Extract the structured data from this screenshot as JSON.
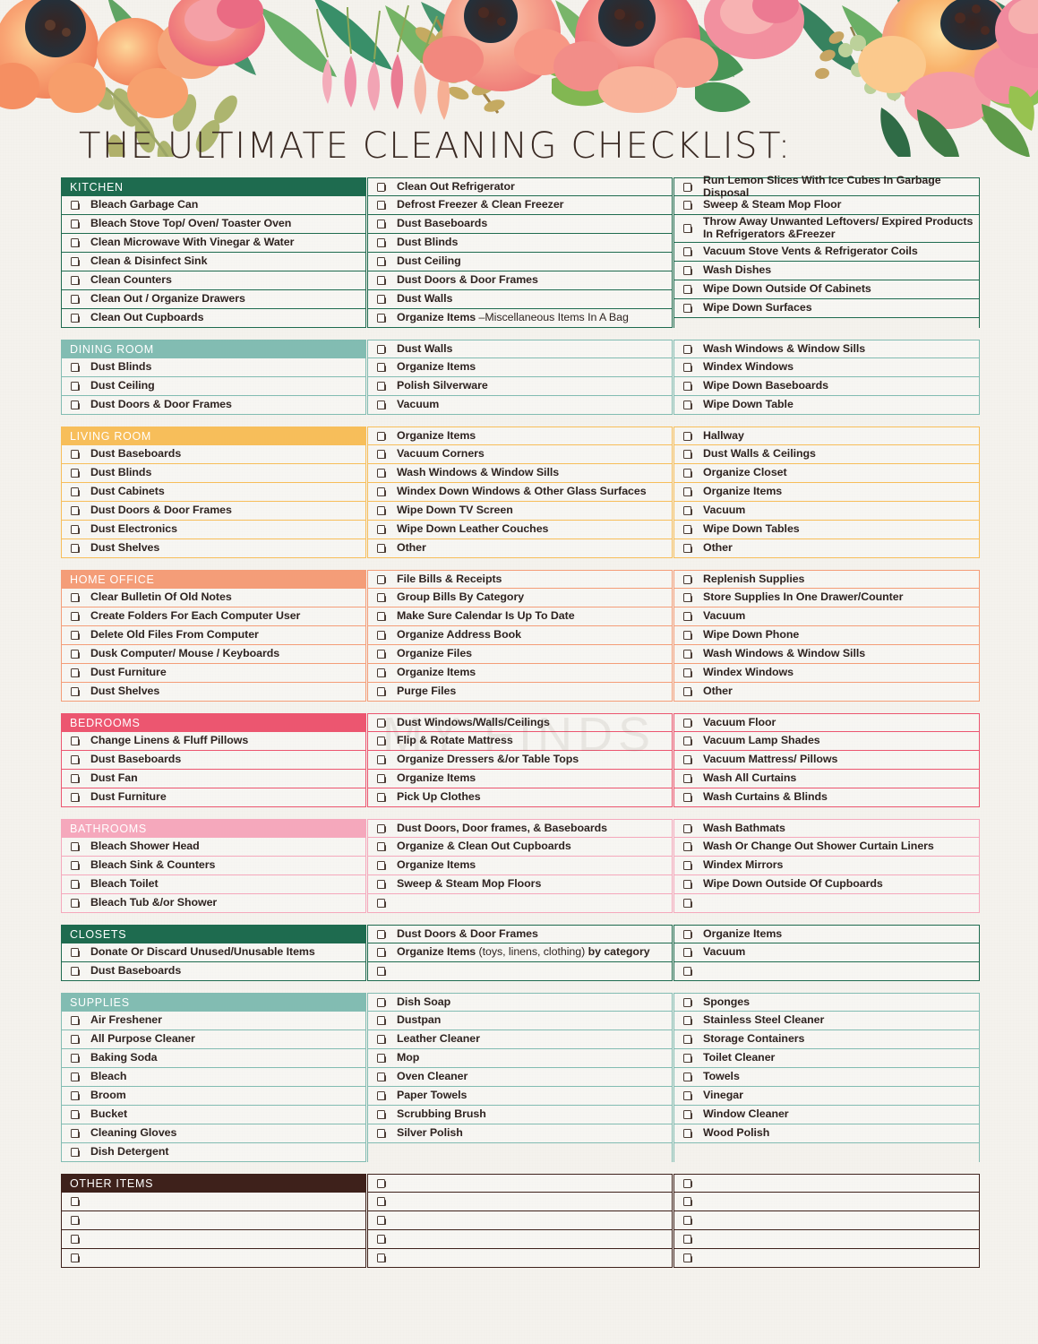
{
  "page": {
    "title": "THE ULTIMATE CLEANING CHECKLIST:",
    "watermark": "MY FINDS"
  },
  "colors": {
    "kitchen": "#1e6b4f",
    "dining_room": "#82bcb2",
    "living_room": "#f7be5a",
    "home_office": "#f49d78",
    "bedrooms": "#ec5670",
    "bathrooms": "#f5a8bc",
    "closets": "#1e6b4f",
    "supplies": "#82bcb2",
    "other_items": "#3e211b",
    "paper": "#f4f2ed",
    "text": "#2e2320"
  },
  "icons": {
    "checkbox": "checkbox-icon"
  },
  "sections": [
    {
      "name": "KITCHEN",
      "key": "kitchen",
      "columns": [
        [
          "Bleach Garbage Can",
          "Bleach Stove Top/ Oven/ Toaster Oven",
          "Clean Microwave With Vinegar & Water",
          "Clean & Disinfect Sink",
          "Clean Counters",
          "Clean Out / Organize Drawers",
          "Clean Out Cupboards"
        ],
        [
          "Clean Out Refrigerator",
          "Defrost Freezer & Clean Freezer",
          "Dust Baseboards",
          "Dust Blinds",
          "Dust Ceiling",
          "Dust Doors & Door Frames",
          "Dust Walls",
          "Organize Items –Miscellaneous Items In A Bag"
        ],
        [
          "Run Lemon Slices With Ice Cubes In Garbage Disposal",
          "Sweep & Steam Mop Floor",
          "Throw Away Unwanted Leftovers/ Expired Products In Refrigerators &Freezer",
          "Vacuum Stove Vents & Refrigerator Coils",
          "Wash Dishes",
          "Wipe Down Outside Of Cabinets",
          "Wipe Down Surfaces"
        ]
      ]
    },
    {
      "name": "DINING ROOM",
      "key": "dining_room",
      "columns": [
        [
          "Dust Blinds",
          "Dust Ceiling",
          "Dust Doors & Door Frames"
        ],
        [
          "Dust Walls",
          "Organize Items",
          "Polish Silverware",
          "Vacuum"
        ],
        [
          "Wash Windows & Window Sills",
          "Windex Windows",
          "Wipe Down Baseboards",
          "Wipe Down Table"
        ]
      ]
    },
    {
      "name": "LIVING ROOM",
      "key": "living_room",
      "columns": [
        [
          "Dust Baseboards",
          "Dust Blinds",
          "Dust Cabinets",
          "Dust Doors & Door Frames",
          "Dust Electronics",
          "Dust Shelves"
        ],
        [
          "Organize Items",
          "Vacuum Corners",
          "Wash Windows & Window Sills",
          "Windex Down Windows & Other Glass Surfaces",
          "Wipe Down TV Screen",
          "Wipe Down Leather Couches",
          "Other"
        ],
        [
          "Hallway",
          "Dust Walls & Ceilings",
          "Organize Closet",
          "Organize Items",
          "Vacuum",
          "Wipe Down Tables",
          "Other"
        ]
      ]
    },
    {
      "name": "HOME OFFICE",
      "key": "home_office",
      "columns": [
        [
          "Clear Bulletin Of Old Notes",
          "Create Folders For Each Computer User",
          "Delete Old Files From Computer",
          "Dusk Computer/ Mouse / Keyboards",
          "Dust Furniture",
          "Dust Shelves"
        ],
        [
          "File Bills & Receipts",
          "Group Bills By Category",
          "Make Sure Calendar Is Up To Date",
          "Organize Address Book",
          "Organize Files",
          "Organize Items",
          "Purge Files"
        ],
        [
          "Replenish Supplies",
          "Store Supplies In One Drawer/Counter",
          "Vacuum",
          "Wipe Down Phone",
          "Wash Windows & Window Sills",
          "Windex Windows",
          "Other"
        ]
      ]
    },
    {
      "name": "BEDROOMS",
      "key": "bedrooms",
      "columns": [
        [
          "Change Linens & Fluff Pillows",
          "Dust Baseboards",
          "Dust Fan",
          "Dust Furniture"
        ],
        [
          "Dust Windows/Walls/Ceilings",
          "Flip & Rotate Mattress",
          "Organize Dressers &/or Table Tops",
          "Organize Items",
          "Pick Up Clothes"
        ],
        [
          "Vacuum Floor",
          "Vacuum Lamp Shades",
          "Vacuum Mattress/ Pillows",
          "Wash All Curtains",
          "Wash Curtains & Blinds"
        ]
      ]
    },
    {
      "name": "BATHROOMS",
      "key": "bathrooms",
      "columns": [
        [
          "Bleach Shower Head",
          "Bleach Sink & Counters",
          "Bleach Toilet",
          "Bleach Tub &/or Shower"
        ],
        [
          "Dust Doors, Door frames, & Baseboards",
          "Organize & Clean Out Cupboards",
          "Organize Items",
          "Sweep & Steam Mop Floors",
          ""
        ],
        [
          "Wash Bathmats",
          "Wash Or Change Out Shower Curtain Liners",
          "Windex Mirrors",
          "Wipe Down Outside Of Cupboards",
          ""
        ]
      ]
    },
    {
      "name": "CLOSETS",
      "key": "closets",
      "columns": [
        [
          "Donate Or Discard Unused/Unusable Items",
          "Dust Baseboards"
        ],
        [
          "Dust Doors & Door Frames",
          "Organize Items (toys, linens, clothing) by category",
          ""
        ],
        [
          "Organize Items",
          "Vacuum",
          ""
        ]
      ]
    },
    {
      "name": "SUPPLIES",
      "key": "supplies",
      "columns": [
        [
          "Air Freshener",
          "All Purpose Cleaner",
          "Baking Soda",
          "Bleach",
          "Broom",
          "Bucket",
          "Cleaning Gloves",
          "Dish Detergent"
        ],
        [
          "Dish Soap",
          "Dustpan",
          "Leather Cleaner",
          "Mop",
          "Oven Cleaner",
          "Paper Towels",
          "Scrubbing Brush",
          "Silver Polish"
        ],
        [
          "Sponges",
          "Stainless Steel Cleaner",
          "Storage Containers",
          "Toilet Cleaner",
          "Towels",
          "Vinegar",
          "Window Cleaner",
          "Wood Polish"
        ]
      ]
    },
    {
      "name": "OTHER ITEMS",
      "key": "other_items",
      "columns": [
        [
          "",
          "",
          "",
          ""
        ],
        [
          "",
          "",
          "",
          "",
          ""
        ],
        [
          "",
          "",
          "",
          "",
          ""
        ]
      ]
    }
  ]
}
